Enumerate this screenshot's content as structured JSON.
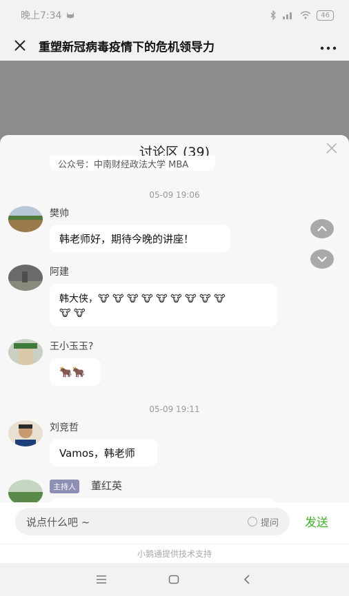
{
  "status_bar": {
    "time": "晚上7:34",
    "battery": "46"
  },
  "header": {
    "title": "重塑新冠病毒疫情下的危机领导力"
  },
  "discussion": {
    "title": "讨论区 (39)",
    "clipped_text": "公众号：中南财经政法大学 MBA",
    "messages": [
      {
        "timestamp": "05-09 19:06",
        "name": "樊帅",
        "text": "韩老师好，期待今晚的讲座！"
      },
      {
        "name": "阿建",
        "line1": "韩大侠，🐮 🐮 🐮 🐮 🐮 🐮 🐮 🐮 🐮",
        "line2": "🐮 🐮"
      },
      {
        "name": "王小玉玉?",
        "text": "🐂🐂"
      },
      {
        "timestamp": "05-09 19:11",
        "name": "刘竞哲",
        "text": "Vamos，韩老师"
      },
      {
        "badge": "主持人",
        "name": "董红英"
      }
    ]
  },
  "input": {
    "placeholder": "说点什么吧 ~",
    "ask_label": "提问",
    "send_label": "发送"
  },
  "footer": {
    "powered_by": "小鹅通提供技术支持"
  },
  "colors": {
    "send_green": "#43b02a",
    "host_badge": "#8e8fb5"
  }
}
